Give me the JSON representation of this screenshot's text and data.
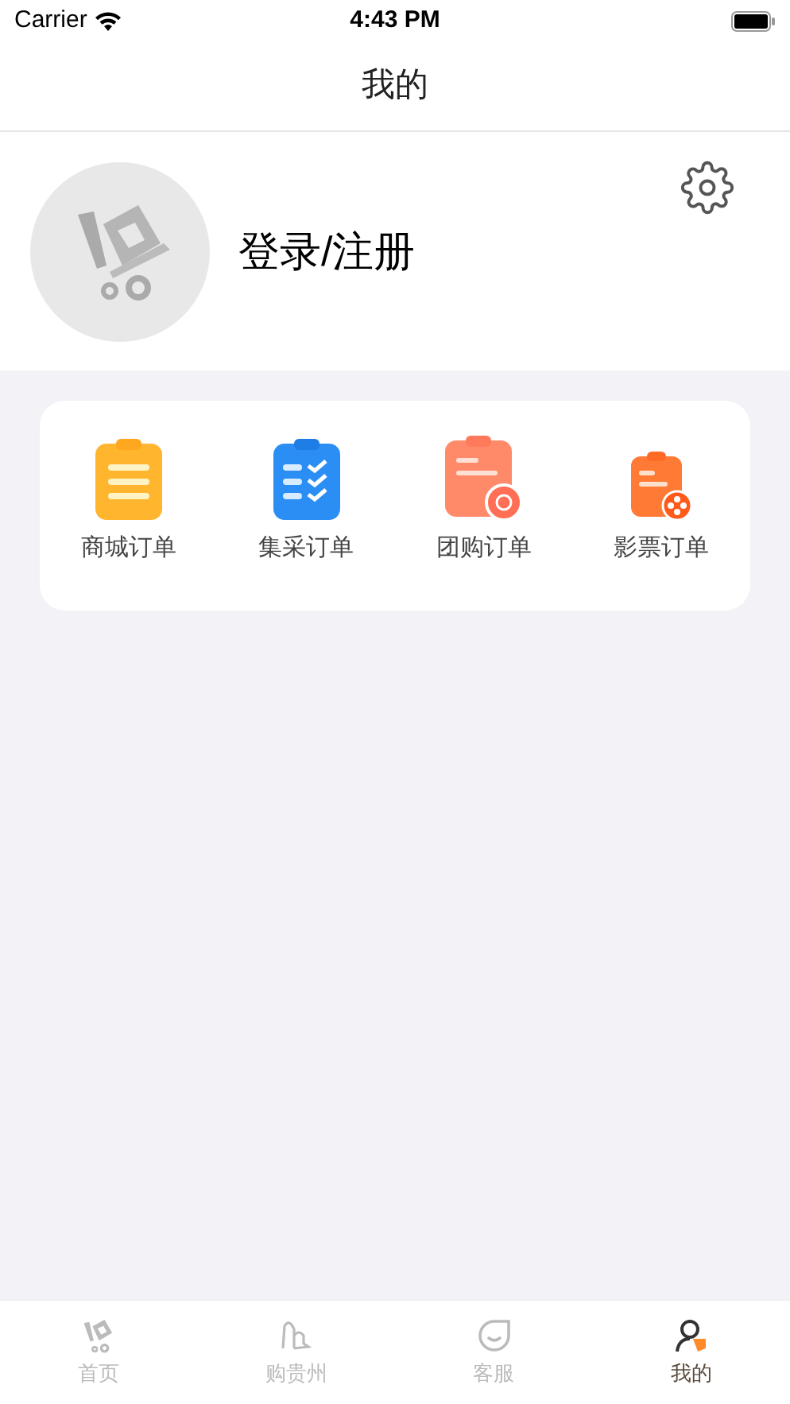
{
  "status_bar": {
    "carrier": "Carrier",
    "time": "4:43 PM"
  },
  "nav_bar": {
    "title": "我的"
  },
  "profile": {
    "login_label": "登录/注册"
  },
  "orders": [
    {
      "label": "商城订单"
    },
    {
      "label": "集采订单"
    },
    {
      "label": "团购订单"
    },
    {
      "label": "影票订单"
    }
  ],
  "tab_bar": [
    {
      "label": "首页",
      "selected": false
    },
    {
      "label": "购贵州",
      "selected": false
    },
    {
      "label": "客服",
      "selected": false
    },
    {
      "label": "我的",
      "selected": true
    }
  ]
}
